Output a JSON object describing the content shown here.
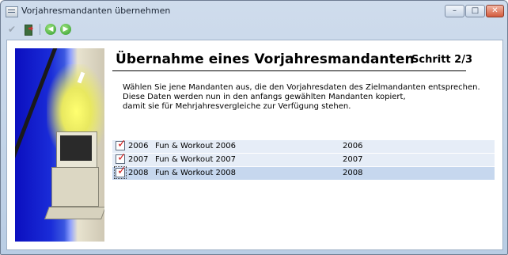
{
  "window": {
    "title": "Vorjahresmandanten übernehmen",
    "minimize_label": "–",
    "maximize_label": "□",
    "close_label": "✕"
  },
  "toolbar": {
    "confirm_icon": "check-icon",
    "exit_icon": "exit-door-icon",
    "back_icon": "back-arrow-icon",
    "forward_icon": "forward-arrow-icon"
  },
  "wizard": {
    "heading": "Übernahme eines Vorjahresmandanten",
    "step": "Schritt 2/3",
    "description": "Wählen Sie jene Mandanten aus, die den Vorjahresdaten des Zielmandanten entsprechen.\nDiese Daten werden nun in den anfangs gewählten Mandanten kopiert,\ndamit sie für Mehrjahresvergleiche zur Verfügung stehen."
  },
  "mandanten": [
    {
      "checked": true,
      "year": "2006",
      "name": "Fun & Workout 2006",
      "value": "2006"
    },
    {
      "checked": true,
      "year": "2007",
      "name": "Fun & Workout 2007",
      "value": "2007"
    },
    {
      "checked": true,
      "year": "2008",
      "name": "Fun & Workout 2008",
      "value": "2008",
      "selected": true
    }
  ],
  "colors": {
    "window_frame": "#b9cde4",
    "checkmark": "#d21f1f",
    "row_background": "#e6edf7",
    "row_selected": "#c6d7ee"
  }
}
